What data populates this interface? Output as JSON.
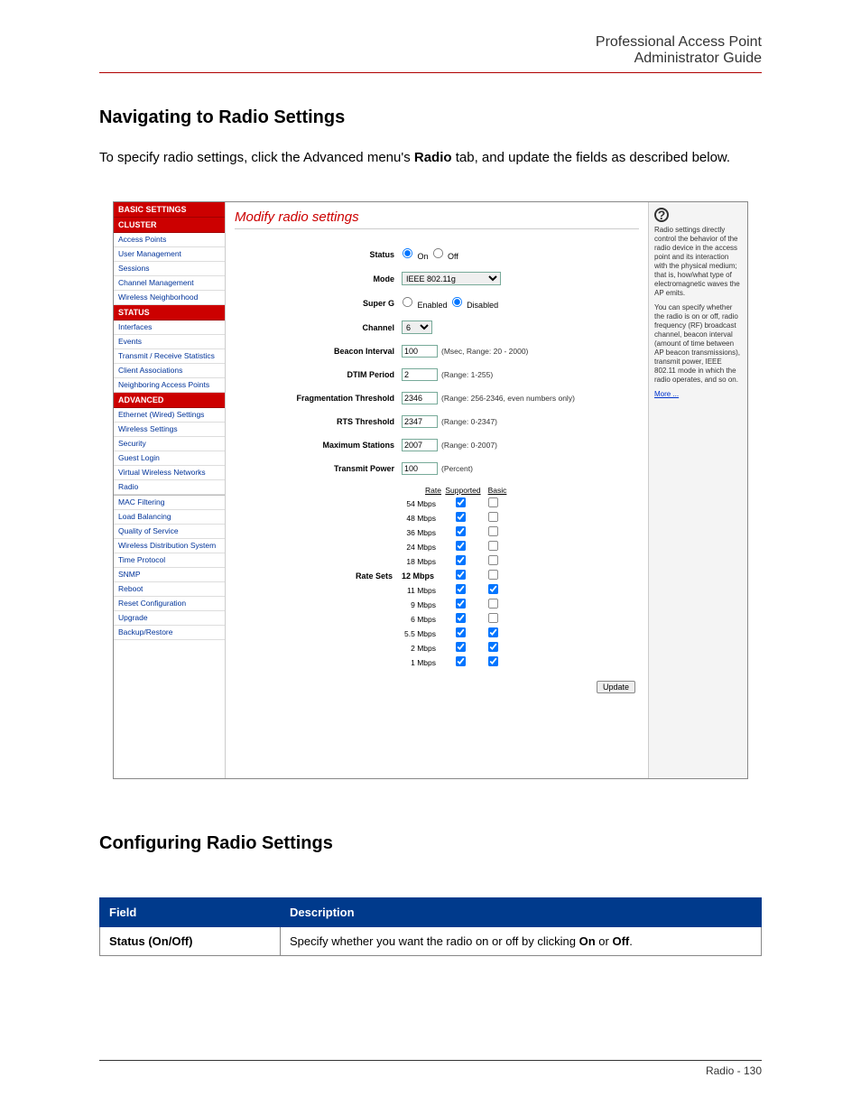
{
  "header": {
    "line1": "Professional Access Point",
    "line2": "Administrator Guide"
  },
  "section1": {
    "title": "Navigating to Radio Settings",
    "intro_pre": "To specify radio settings, click the Advanced menu's ",
    "intro_bold": "Radio",
    "intro_post": " tab, and update the fields as described below."
  },
  "sidebar": {
    "groups": [
      {
        "header": "BASIC SETTINGS",
        "items": []
      },
      {
        "header": "CLUSTER",
        "items": [
          "Access Points",
          "User Management",
          "Sessions",
          "Channel Management",
          "Wireless Neighborhood"
        ]
      },
      {
        "header": "STATUS",
        "items": [
          "Interfaces",
          "Events",
          "Transmit / Receive Statistics",
          "Client Associations",
          "Neighboring Access Points"
        ]
      },
      {
        "header": "ADVANCED",
        "items": [
          "Ethernet (Wired) Settings",
          "Wireless Settings",
          "Security",
          "Guest Login",
          "Virtual Wireless Networks",
          "Radio",
          "",
          "MAC Filtering",
          "Load Balancing",
          "Quality of Service",
          "Wireless Distribution System",
          "Time Protocol",
          "SNMP",
          "Reboot",
          "Reset Configuration",
          "Upgrade",
          "Backup/Restore"
        ]
      }
    ]
  },
  "panel": {
    "title": "Modify radio settings",
    "status": {
      "label": "Status",
      "on": "On",
      "off": "Off",
      "value": "on"
    },
    "mode": {
      "label": "Mode",
      "value": "IEEE 802.11g"
    },
    "superg": {
      "label": "Super G",
      "enabled": "Enabled",
      "disabled": "Disabled",
      "value": "disabled"
    },
    "channel": {
      "label": "Channel",
      "value": "6"
    },
    "beacon": {
      "label": "Beacon Interval",
      "value": "100",
      "hint": "(Msec, Range: 20 - 2000)"
    },
    "dtim": {
      "label": "DTIM Period",
      "value": "2",
      "hint": "(Range: 1-255)"
    },
    "frag": {
      "label": "Fragmentation Threshold",
      "value": "2346",
      "hint": "(Range: 256-2346, even numbers only)"
    },
    "rts": {
      "label": "RTS Threshold",
      "value": "2347",
      "hint": "(Range: 0-2347)"
    },
    "maxsta": {
      "label": "Maximum Stations",
      "value": "2007",
      "hint": "(Range: 0-2007)"
    },
    "txpwr": {
      "label": "Transmit Power",
      "value": "100",
      "hint": "(Percent)"
    },
    "rate_sets_label": "Rate Sets",
    "rate_headers": [
      "Rate",
      "Supported",
      "Basic"
    ],
    "rates": [
      {
        "label": "54 Mbps",
        "sup": true,
        "basic": false
      },
      {
        "label": "48 Mbps",
        "sup": true,
        "basic": false
      },
      {
        "label": "36 Mbps",
        "sup": true,
        "basic": false
      },
      {
        "label": "24 Mbps",
        "sup": true,
        "basic": false
      },
      {
        "label": "18 Mbps",
        "sup": true,
        "basic": false
      },
      {
        "label": "12 Mbps",
        "sup": true,
        "basic": false
      },
      {
        "label": "11 Mbps",
        "sup": true,
        "basic": true
      },
      {
        "label": "9 Mbps",
        "sup": true,
        "basic": false
      },
      {
        "label": "6 Mbps",
        "sup": true,
        "basic": false
      },
      {
        "label": "5.5 Mbps",
        "sup": true,
        "basic": true
      },
      {
        "label": "2 Mbps",
        "sup": true,
        "basic": true
      },
      {
        "label": "1 Mbps",
        "sup": true,
        "basic": true
      }
    ],
    "update": "Update"
  },
  "help": {
    "p1": "Radio settings directly control the behavior of the radio device in the access point and its interaction with the physical medium; that is, how/what type of electromagnetic waves the AP emits.",
    "p2": "You can specify whether the radio is on or off, radio frequency (RF) broadcast channel, beacon interval (amount of time between AP beacon transmissions), transmit power, IEEE 802.11 mode in which the radio operates, and so on.",
    "more": "More ..."
  },
  "section2": {
    "title": "Configuring Radio Settings"
  },
  "table": {
    "h1": "Field",
    "h2": "Description",
    "r1c1": "Status (On/Off)",
    "r1c2_pre": "Specify whether you want the radio on or off by clicking ",
    "r1c2_b1": "On",
    "r1c2_mid": " or ",
    "r1c2_b2": "Off",
    "r1c2_post": "."
  },
  "footer": {
    "text": "Radio - 130"
  }
}
